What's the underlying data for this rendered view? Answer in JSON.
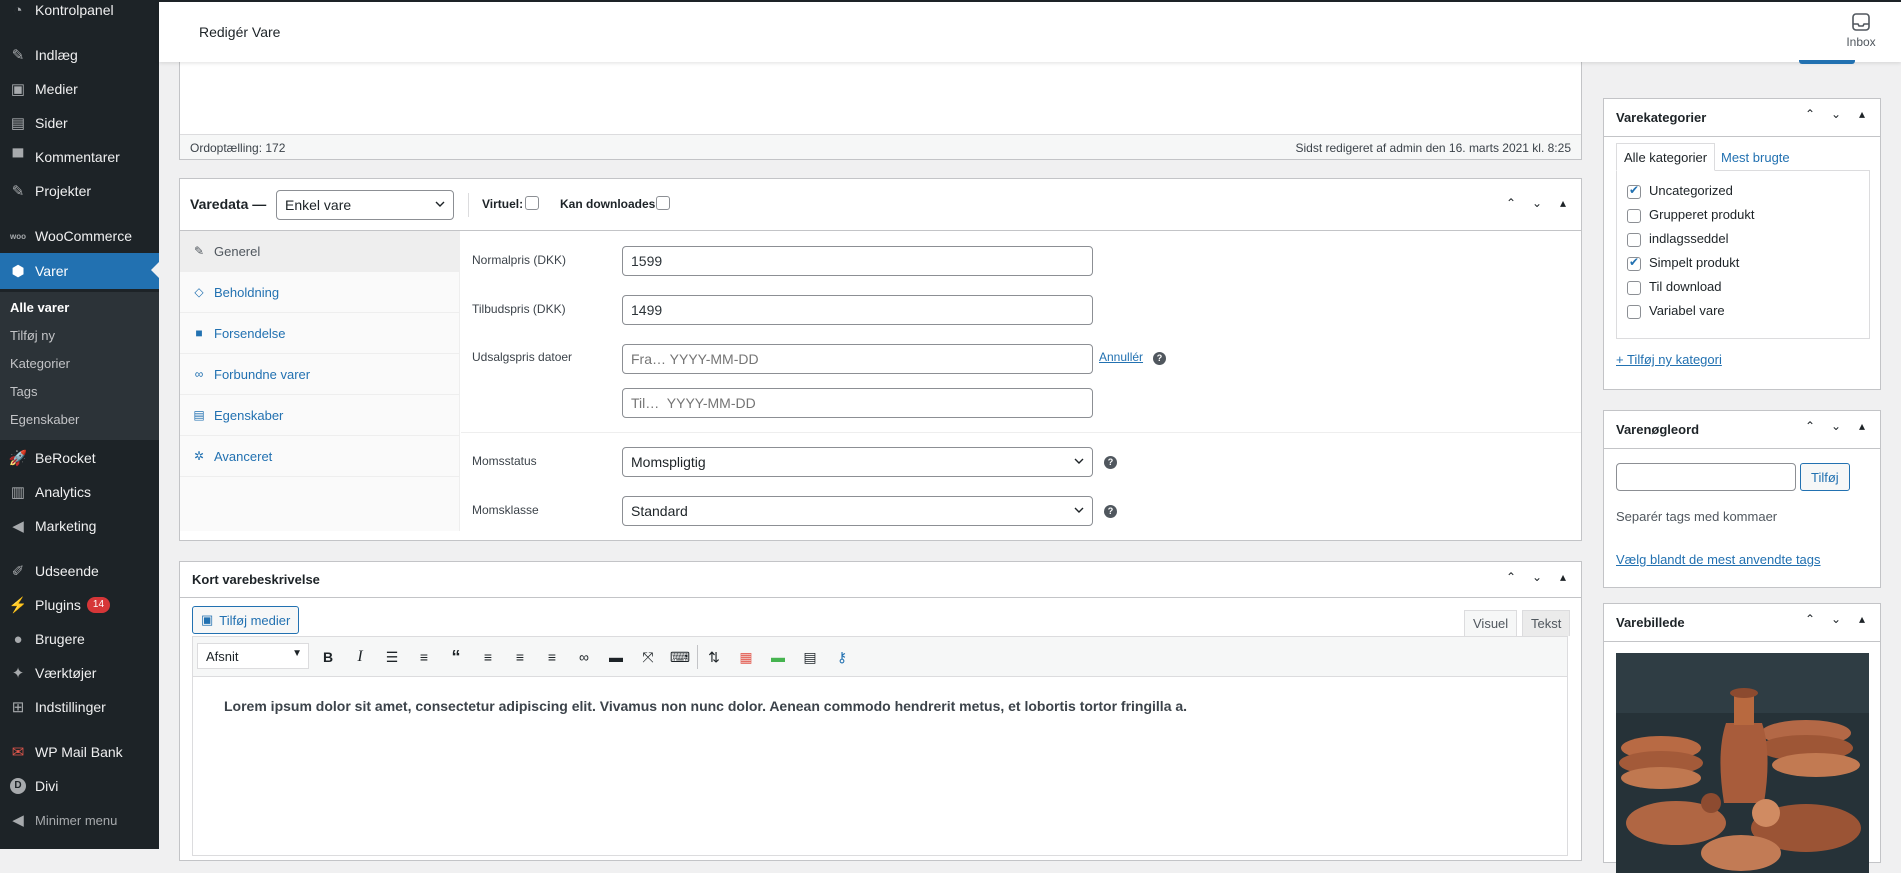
{
  "sidebar": {
    "items": [
      {
        "label": "Kontrolpanel",
        "icon": "dashboard-icon"
      },
      {
        "label": "Indlæg",
        "icon": "pin-icon"
      },
      {
        "label": "Medier",
        "icon": "media-icon"
      },
      {
        "label": "Sider",
        "icon": "pages-icon"
      },
      {
        "label": "Kommentarer",
        "icon": "comment-icon"
      },
      {
        "label": "Projekter",
        "icon": "pin-icon"
      },
      {
        "label": "WooCommerce",
        "icon": "woo-icon"
      },
      {
        "label": "Varer",
        "icon": "box-icon"
      },
      {
        "label": "BeRocket",
        "icon": "rocket-icon"
      },
      {
        "label": "Analytics",
        "icon": "chart-icon"
      },
      {
        "label": "Marketing",
        "icon": "megaphone-icon"
      },
      {
        "label": "Udseende",
        "icon": "brush-icon"
      },
      {
        "label": "Plugins",
        "icon": "plugin-icon"
      },
      {
        "label": "Brugere",
        "icon": "user-icon"
      },
      {
        "label": "Værktøjer",
        "icon": "wrench-icon"
      },
      {
        "label": "Indstillinger",
        "icon": "settings-icon"
      },
      {
        "label": "WP Mail Bank",
        "icon": "mail-bank-icon"
      },
      {
        "label": "Divi",
        "icon": "divi-icon"
      },
      {
        "label": "Minimer menu",
        "icon": "collapse-icon"
      }
    ],
    "submenu": [
      "Alle varer",
      "Tilføj ny",
      "Kategorier",
      "Tags",
      "Egenskaber"
    ],
    "plugins_badge": "14"
  },
  "topbar": {
    "title": "Redigér Vare",
    "inbox_label": "Inbox"
  },
  "editor_status": {
    "word_count": "Ordoptælling: 172",
    "last_edited": "Sidst redigeret af admin den 16. marts 2021 kl. 8:25"
  },
  "product_data": {
    "title": "Varedata —",
    "type_value": "Enkel vare",
    "virtual_label": "Virtuel:",
    "downloadable_label": "Kan downloades:",
    "tabs": [
      "Generel",
      "Beholdning",
      "Forsendelse",
      "Forbundne varer",
      "Egenskaber",
      "Avanceret"
    ],
    "regular_price_label": "Normalpris (DKK)",
    "regular_price": "1599",
    "sale_price_label": "Tilbudspris (DKK)",
    "sale_price": "1499",
    "sale_dates_label": "Udsalgspris datoer",
    "date_from_placeholder": "Fra… YYYY-MM-DD",
    "date_to_placeholder": "Til…  YYYY-MM-DD",
    "cancel_link": "Annullér",
    "tax_status_label": "Momsstatus",
    "tax_status": "Momspligtig",
    "tax_class_label": "Momsklasse",
    "tax_class": "Standard"
  },
  "short_desc": {
    "title": "Kort varebeskrivelse",
    "add_media": "Tilføj medier",
    "tab_visual": "Visuel",
    "tab_text": "Tekst",
    "format": "Afsnit",
    "content": "Lorem ipsum dolor sit amet, consectetur adipiscing elit. Vivamus non nunc dolor. Aenean commodo hendrerit metus, et lobortis tortor fringilla a."
  },
  "categories": {
    "title": "Varekategorier",
    "tab_all": "Alle kategorier",
    "tab_most": "Mest brugte",
    "items": [
      {
        "label": "Uncategorized",
        "checked": true
      },
      {
        "label": "Grupperet produkt",
        "checked": false
      },
      {
        "label": "indlagsseddel",
        "checked": false
      },
      {
        "label": "Simpelt produkt",
        "checked": true
      },
      {
        "label": "Til download",
        "checked": false
      },
      {
        "label": "Variabel vare",
        "checked": false
      }
    ],
    "add_link": "+ Tilføj ny kategori"
  },
  "tags": {
    "title": "Varenøgleord",
    "add_button": "Tilføj",
    "hint": "Separér tags med kommaer",
    "choose_link": "Vælg blandt de mest anvendte tags"
  },
  "image": {
    "title": "Varebillede"
  }
}
